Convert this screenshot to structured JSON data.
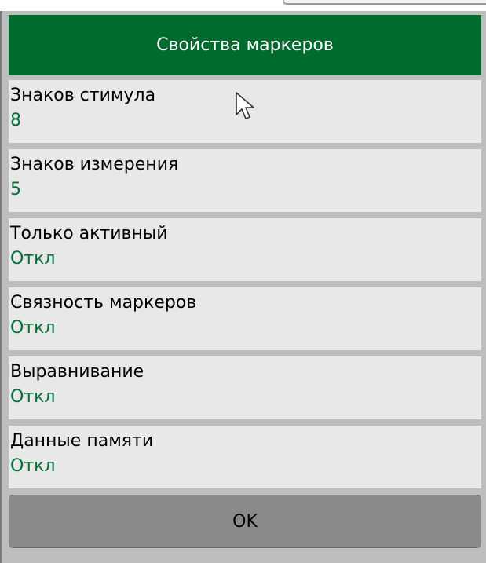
{
  "dialog": {
    "title": "Свойства маркеров",
    "items": [
      {
        "label": "Знаков стимула",
        "value": "8"
      },
      {
        "label": "Знаков измерения",
        "value": "5"
      },
      {
        "label": "Только активный",
        "value": "Откл"
      },
      {
        "label": "Связность маркеров",
        "value": "Откл"
      },
      {
        "label": "Выравнивание",
        "value": "Откл"
      },
      {
        "label": "Данные памяти",
        "value": "Откл"
      }
    ],
    "ok_label": "OK"
  },
  "colors": {
    "header_bg": "#006b2e",
    "value_text": "#00703a",
    "item_bg": "#e8e8e8",
    "button_bg": "#8a8a8a"
  },
  "icons": {
    "cursor": "mouse-pointer-icon"
  }
}
